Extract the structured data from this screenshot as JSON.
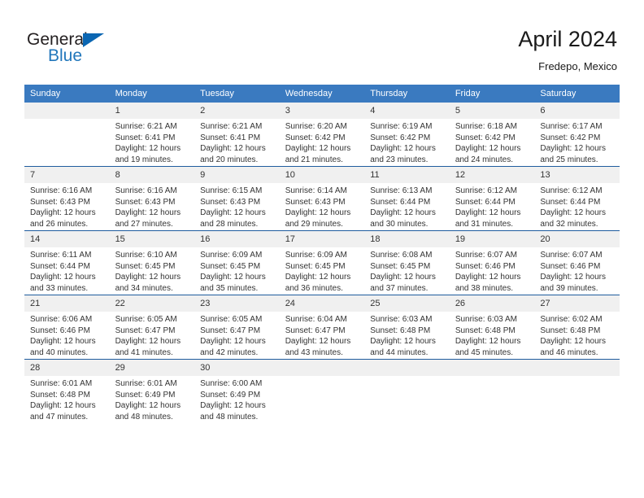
{
  "logo": {
    "word1": "General",
    "word2": "Blue",
    "triangle_color": "#0b66b2",
    "word2_color": "#2277bb"
  },
  "header": {
    "title": "April 2024",
    "subtitle": "Fredepo, Mexico"
  },
  "theme": {
    "header_blue": "#3a7ac0",
    "row_divider": "#1f5c9e",
    "daynum_band": "#f0f0f0",
    "text": "#333333"
  },
  "calendar": {
    "weekday_headers": [
      "Sunday",
      "Monday",
      "Tuesday",
      "Wednesday",
      "Thursday",
      "Friday",
      "Saturday"
    ],
    "weeks": [
      [
        {
          "day": "",
          "lines": []
        },
        {
          "day": "1",
          "lines": [
            "Sunrise: 6:21 AM",
            "Sunset: 6:41 PM",
            "Daylight: 12 hours",
            "and 19 minutes."
          ]
        },
        {
          "day": "2",
          "lines": [
            "Sunrise: 6:21 AM",
            "Sunset: 6:41 PM",
            "Daylight: 12 hours",
            "and 20 minutes."
          ]
        },
        {
          "day": "3",
          "lines": [
            "Sunrise: 6:20 AM",
            "Sunset: 6:42 PM",
            "Daylight: 12 hours",
            "and 21 minutes."
          ]
        },
        {
          "day": "4",
          "lines": [
            "Sunrise: 6:19 AM",
            "Sunset: 6:42 PM",
            "Daylight: 12 hours",
            "and 23 minutes."
          ]
        },
        {
          "day": "5",
          "lines": [
            "Sunrise: 6:18 AM",
            "Sunset: 6:42 PM",
            "Daylight: 12 hours",
            "and 24 minutes."
          ]
        },
        {
          "day": "6",
          "lines": [
            "Sunrise: 6:17 AM",
            "Sunset: 6:42 PM",
            "Daylight: 12 hours",
            "and 25 minutes."
          ]
        }
      ],
      [
        {
          "day": "7",
          "lines": [
            "Sunrise: 6:16 AM",
            "Sunset: 6:43 PM",
            "Daylight: 12 hours",
            "and 26 minutes."
          ]
        },
        {
          "day": "8",
          "lines": [
            "Sunrise: 6:16 AM",
            "Sunset: 6:43 PM",
            "Daylight: 12 hours",
            "and 27 minutes."
          ]
        },
        {
          "day": "9",
          "lines": [
            "Sunrise: 6:15 AM",
            "Sunset: 6:43 PM",
            "Daylight: 12 hours",
            "and 28 minutes."
          ]
        },
        {
          "day": "10",
          "lines": [
            "Sunrise: 6:14 AM",
            "Sunset: 6:43 PM",
            "Daylight: 12 hours",
            "and 29 minutes."
          ]
        },
        {
          "day": "11",
          "lines": [
            "Sunrise: 6:13 AM",
            "Sunset: 6:44 PM",
            "Daylight: 12 hours",
            "and 30 minutes."
          ]
        },
        {
          "day": "12",
          "lines": [
            "Sunrise: 6:12 AM",
            "Sunset: 6:44 PM",
            "Daylight: 12 hours",
            "and 31 minutes."
          ]
        },
        {
          "day": "13",
          "lines": [
            "Sunrise: 6:12 AM",
            "Sunset: 6:44 PM",
            "Daylight: 12 hours",
            "and 32 minutes."
          ]
        }
      ],
      [
        {
          "day": "14",
          "lines": [
            "Sunrise: 6:11 AM",
            "Sunset: 6:44 PM",
            "Daylight: 12 hours",
            "and 33 minutes."
          ]
        },
        {
          "day": "15",
          "lines": [
            "Sunrise: 6:10 AM",
            "Sunset: 6:45 PM",
            "Daylight: 12 hours",
            "and 34 minutes."
          ]
        },
        {
          "day": "16",
          "lines": [
            "Sunrise: 6:09 AM",
            "Sunset: 6:45 PM",
            "Daylight: 12 hours",
            "and 35 minutes."
          ]
        },
        {
          "day": "17",
          "lines": [
            "Sunrise: 6:09 AM",
            "Sunset: 6:45 PM",
            "Daylight: 12 hours",
            "and 36 minutes."
          ]
        },
        {
          "day": "18",
          "lines": [
            "Sunrise: 6:08 AM",
            "Sunset: 6:45 PM",
            "Daylight: 12 hours",
            "and 37 minutes."
          ]
        },
        {
          "day": "19",
          "lines": [
            "Sunrise: 6:07 AM",
            "Sunset: 6:46 PM",
            "Daylight: 12 hours",
            "and 38 minutes."
          ]
        },
        {
          "day": "20",
          "lines": [
            "Sunrise: 6:07 AM",
            "Sunset: 6:46 PM",
            "Daylight: 12 hours",
            "and 39 minutes."
          ]
        }
      ],
      [
        {
          "day": "21",
          "lines": [
            "Sunrise: 6:06 AM",
            "Sunset: 6:46 PM",
            "Daylight: 12 hours",
            "and 40 minutes."
          ]
        },
        {
          "day": "22",
          "lines": [
            "Sunrise: 6:05 AM",
            "Sunset: 6:47 PM",
            "Daylight: 12 hours",
            "and 41 minutes."
          ]
        },
        {
          "day": "23",
          "lines": [
            "Sunrise: 6:05 AM",
            "Sunset: 6:47 PM",
            "Daylight: 12 hours",
            "and 42 minutes."
          ]
        },
        {
          "day": "24",
          "lines": [
            "Sunrise: 6:04 AM",
            "Sunset: 6:47 PM",
            "Daylight: 12 hours",
            "and 43 minutes."
          ]
        },
        {
          "day": "25",
          "lines": [
            "Sunrise: 6:03 AM",
            "Sunset: 6:48 PM",
            "Daylight: 12 hours",
            "and 44 minutes."
          ]
        },
        {
          "day": "26",
          "lines": [
            "Sunrise: 6:03 AM",
            "Sunset: 6:48 PM",
            "Daylight: 12 hours",
            "and 45 minutes."
          ]
        },
        {
          "day": "27",
          "lines": [
            "Sunrise: 6:02 AM",
            "Sunset: 6:48 PM",
            "Daylight: 12 hours",
            "and 46 minutes."
          ]
        }
      ],
      [
        {
          "day": "28",
          "lines": [
            "Sunrise: 6:01 AM",
            "Sunset: 6:48 PM",
            "Daylight: 12 hours",
            "and 47 minutes."
          ]
        },
        {
          "day": "29",
          "lines": [
            "Sunrise: 6:01 AM",
            "Sunset: 6:49 PM",
            "Daylight: 12 hours",
            "and 48 minutes."
          ]
        },
        {
          "day": "30",
          "lines": [
            "Sunrise: 6:00 AM",
            "Sunset: 6:49 PM",
            "Daylight: 12 hours",
            "and 48 minutes."
          ]
        },
        {
          "day": "",
          "lines": []
        },
        {
          "day": "",
          "lines": []
        },
        {
          "day": "",
          "lines": []
        },
        {
          "day": "",
          "lines": []
        }
      ]
    ]
  }
}
